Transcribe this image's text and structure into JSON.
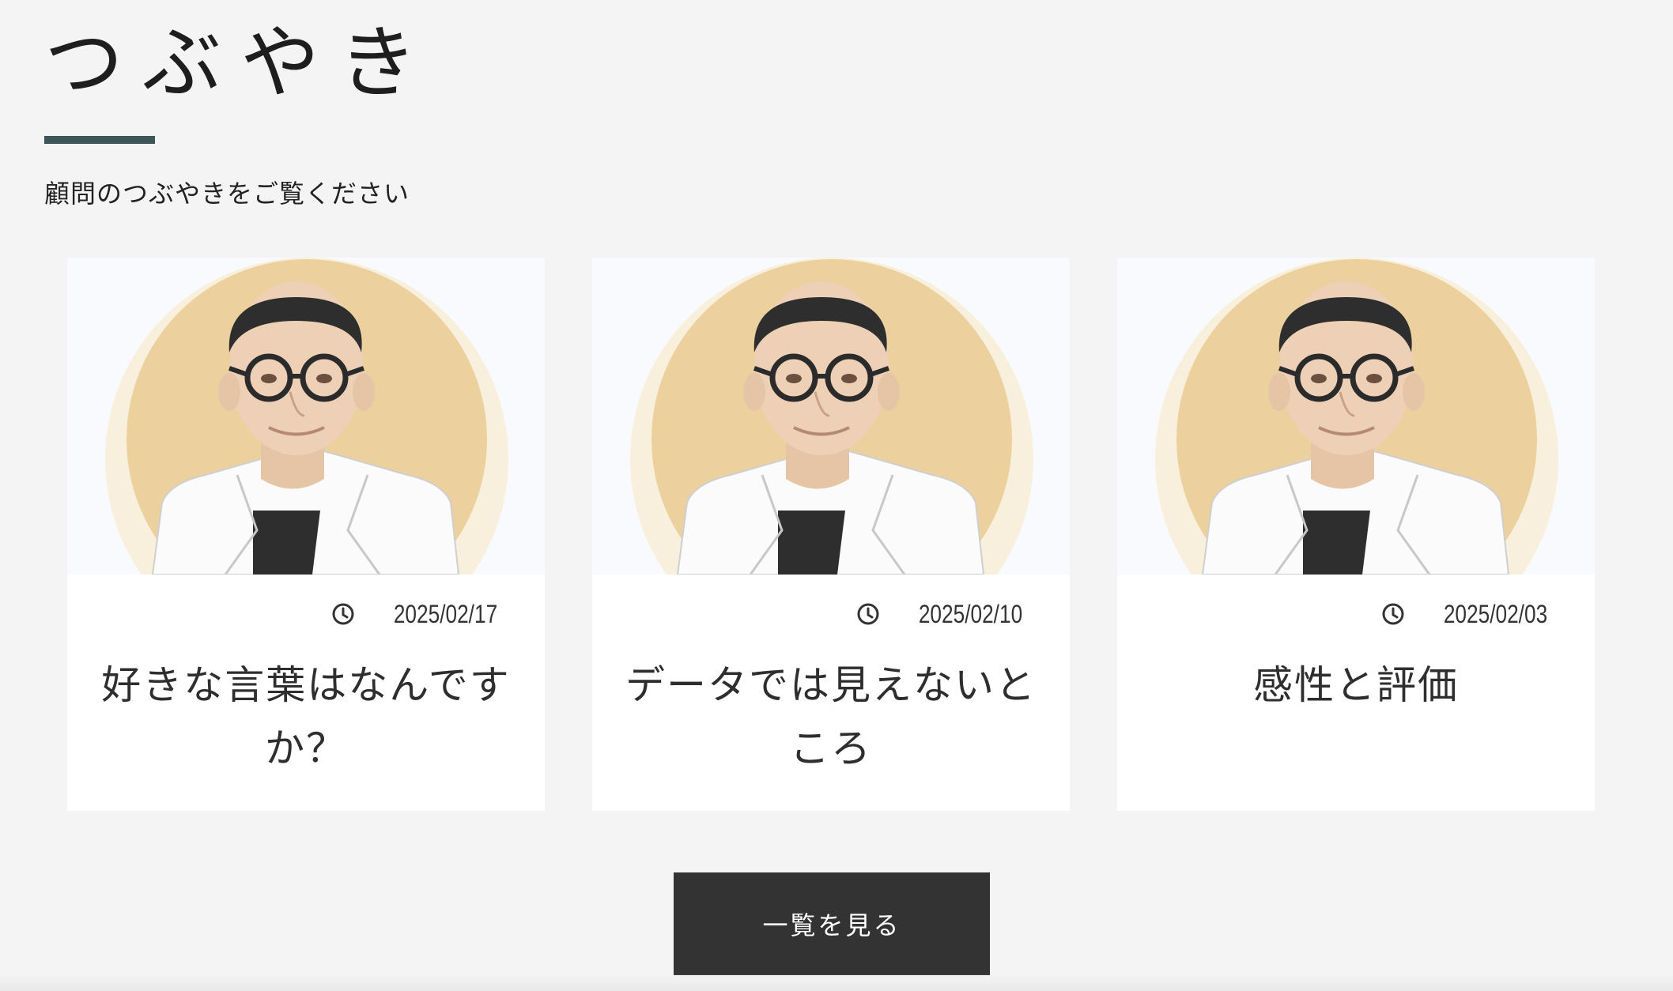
{
  "section": {
    "title": "つぶやき",
    "subtitle": "顧問のつぶやきをご覧ください"
  },
  "posts": [
    {
      "date": "2025/02/17",
      "title": "好きな言葉はなんですか？"
    },
    {
      "date": "2025/02/10",
      "title": "データでは見えないところ"
    },
    {
      "date": "2025/02/03",
      "title": "感性と評価"
    }
  ],
  "more_button": {
    "label": "一覧を見る"
  },
  "icons": {
    "date": "clock-icon",
    "thumbnail": "advisor-portrait"
  },
  "colors": {
    "accent_bar": "#3e5557",
    "button_bg": "#333333",
    "portrait_circle": "#ecd19f",
    "portrait_halo": "#f8f0dc"
  }
}
